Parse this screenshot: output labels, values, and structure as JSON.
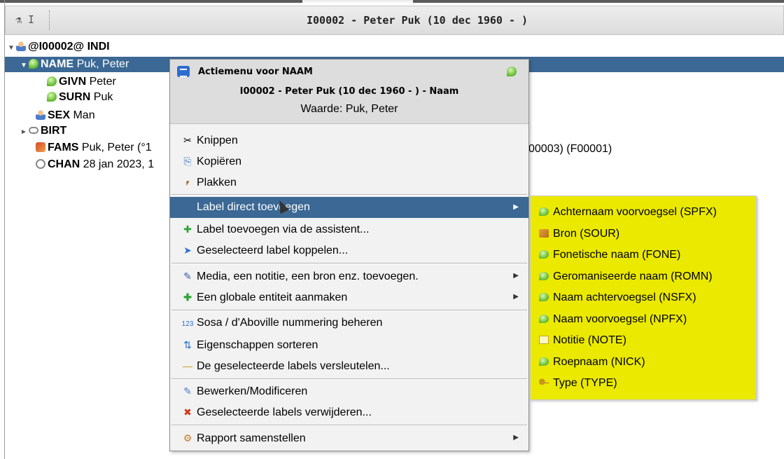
{
  "window": {
    "title": "I00002 - Peter Puk (10 dec 1960 - )",
    "tools": "⚗ I"
  },
  "tree": {
    "root": {
      "tag": "@I00002@ INDI"
    },
    "name": {
      "tag": "NAME",
      "value": "Puk, Peter"
    },
    "givn": {
      "tag": "GIVN",
      "value": "Peter"
    },
    "surn": {
      "tag": "SURN",
      "value": "Puk"
    },
    "sex": {
      "tag": "SEX",
      "value": "Man"
    },
    "birt": {
      "tag": "BIRT",
      "value": ""
    },
    "fams": {
      "tag": "FAMS",
      "value": "Puk, Peter (°1",
      "tail": "00003) (F00001)"
    },
    "chan": {
      "tag": "CHAN",
      "value": "28 jan 2023, 1"
    }
  },
  "menu": {
    "header_title": "Actiemenu voor NAAM",
    "header_subject": "I00002 - Peter  Puk (10 dec 1960 - ) - Naam",
    "header_value": "Waarde: Puk, Peter",
    "items": {
      "cut": "Knippen",
      "copy": "Kopiëren",
      "paste": "Plakken",
      "add_direct": "Label direct toevoegen",
      "add_wizard": "Label toevoegen via de assistent...",
      "link": "Geselecteerd label koppelen...",
      "media": "Media, een notitie, een bron enz. toevoegen.",
      "global": "Een globale entiteit aanmaken",
      "sosa": "Sosa / d'Aboville nummering beheren",
      "sort": "Eigenschappen sorteren",
      "encrypt": "De geselecteerde labels versleutelen...",
      "edit": "Bewerken/Modificeren",
      "delete": "Geselecteerde labels verwijderen...",
      "report": "Rapport samenstellen"
    },
    "icons": {
      "cut": "✂",
      "copy": "⎘",
      "paste": "⎖",
      "add_wizard": "✚",
      "link": "➤",
      "media": "✎",
      "global": "✚",
      "sosa": "123",
      "sort": "⇅",
      "encrypt": "—",
      "edit": "✎",
      "delete": "✖",
      "report": "⚙"
    }
  },
  "submenu": {
    "items": [
      {
        "label": "Achternaam voorvoegsel (SPFX)",
        "icon": "green"
      },
      {
        "label": "Bron (SOUR)",
        "icon": "book"
      },
      {
        "label": "Fonetische naam (FONE)",
        "icon": "green"
      },
      {
        "label": "Geromaniseerde naam (ROMN)",
        "icon": "green"
      },
      {
        "label": "Naam achtervoegsel (NSFX)",
        "icon": "green"
      },
      {
        "label": "Naam voorvoegsel (NPFX)",
        "icon": "green"
      },
      {
        "label": "Notitie (NOTE)",
        "icon": "note"
      },
      {
        "label": "Roepnaam (NICK)",
        "icon": "green"
      },
      {
        "label": "Type (TYPE)",
        "icon": "key"
      }
    ],
    "bg_color": "#ebe900"
  },
  "colors": {
    "selection": "#3b6894"
  }
}
